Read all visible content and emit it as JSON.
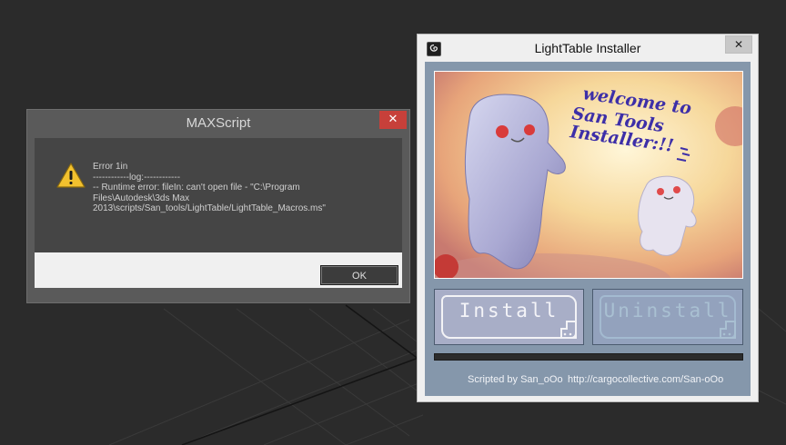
{
  "maxscript_dialog": {
    "title": "MAXScript",
    "close_glyph": "✕",
    "icon": "warning-icon",
    "message_lines": [
      "Error 1in",
      "------------log:------------",
      "-- Runtime error: fileIn: can't open file - \"C:\\Program",
      "Files\\Autodesk\\3ds Max",
      "2013\\scripts/San_tools/LightTable/LightTable_Macros.ms\""
    ],
    "ok_label": "OK"
  },
  "installer_window": {
    "title": "LightTable Installer",
    "close_glyph": "✕",
    "app_icon": "3ds-max-icon",
    "banner": {
      "welcome_lines": [
        "welcome to",
        "San Tools",
        "Installer:!!"
      ]
    },
    "install_label": "Install",
    "uninstall_label": "Uninstall",
    "progress": 0,
    "footer": {
      "credit": "Scripted by San_oOo",
      "url": "http://cargocollective.com/San-oOo"
    }
  },
  "colors": {
    "viewport_bg": "#2b2b2b",
    "close_red": "#c7403a",
    "installer_client": "#8597ab"
  }
}
